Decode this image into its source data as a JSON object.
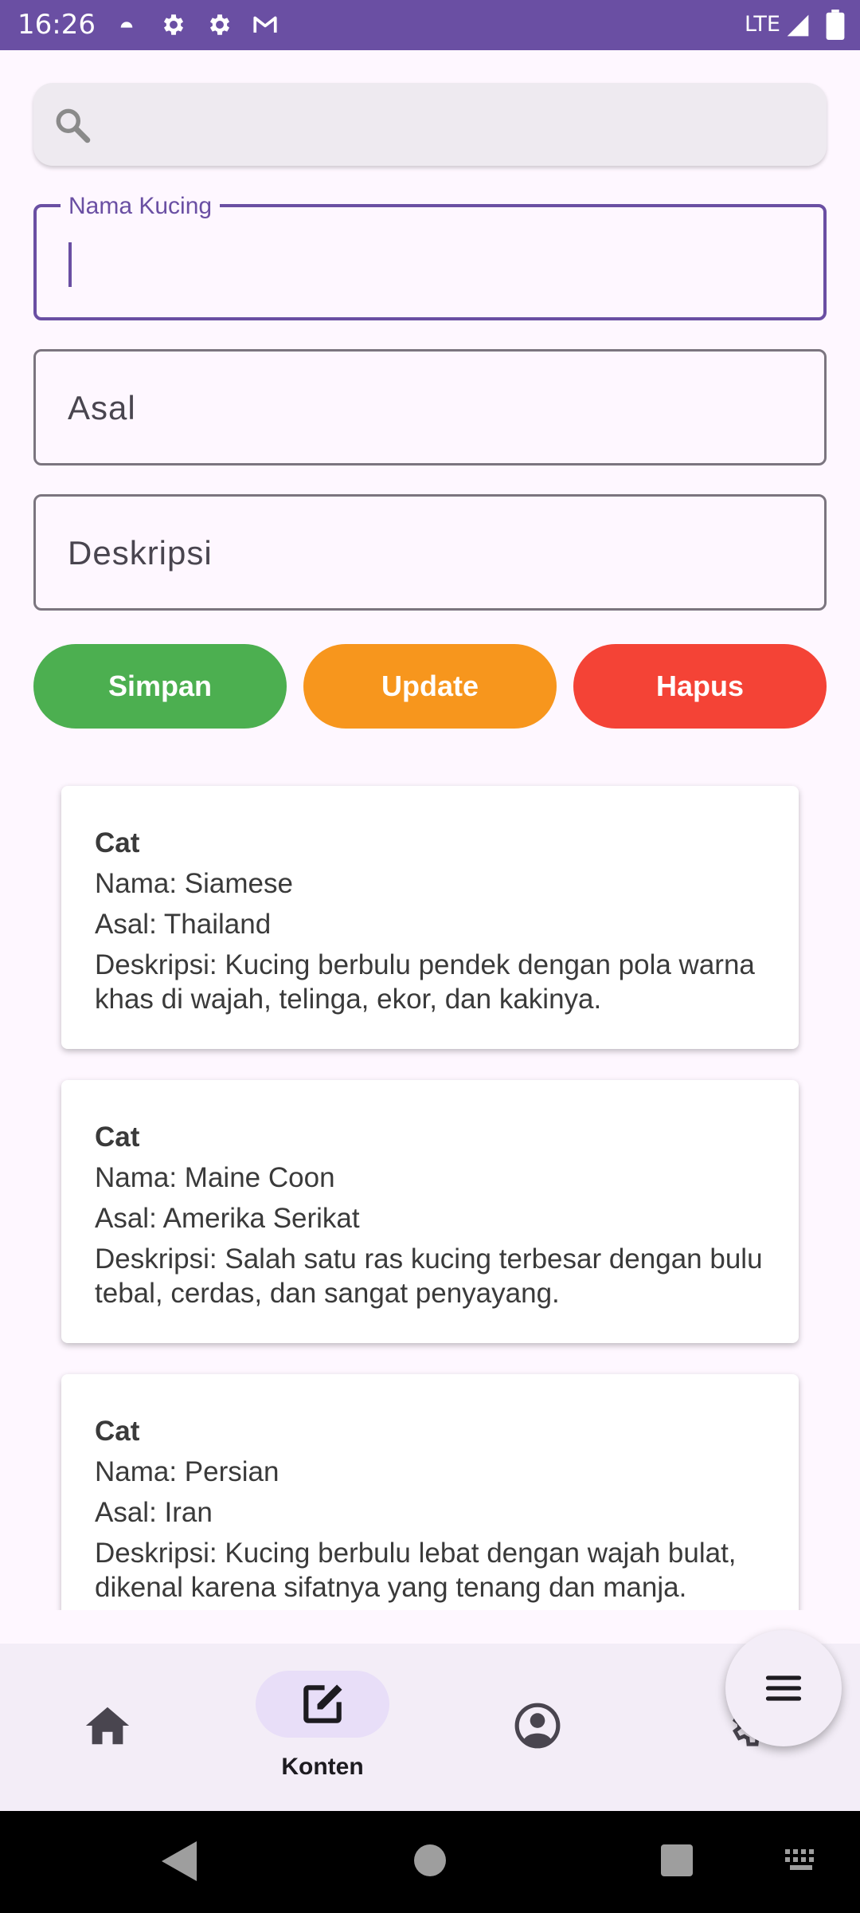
{
  "status_bar": {
    "time": "16:26",
    "network": "LTE",
    "icons": [
      "cloud-icon",
      "gear-icon",
      "gear-icon",
      "gmail-icon",
      "signal-icon",
      "battery-icon"
    ]
  },
  "search": {
    "placeholder": "",
    "value": ""
  },
  "form": {
    "name_label": "Nama Kucing",
    "name_value": "",
    "origin_placeholder": "Asal",
    "description_placeholder": "Deskripsi"
  },
  "buttons": {
    "save": "Simpan",
    "update": "Update",
    "delete": "Hapus"
  },
  "cats": [
    {
      "title": "Cat",
      "name": "Nama: Siamese",
      "origin": "Asal: Thailand",
      "description": "Deskripsi:  Kucing berbulu pendek dengan pola warna khas di wajah, telinga, ekor, dan kakinya."
    },
    {
      "title": "Cat",
      "name": "Nama: Maine Coon",
      "origin": "Asal: Amerika Serikat",
      "description": "Deskripsi: Salah satu ras kucing terbesar dengan bulu tebal, cerdas, dan sangat penyayang."
    },
    {
      "title": "Cat",
      "name": "Nama: Persian",
      "origin": "Asal: Iran",
      "description": "Deskripsi: Kucing berbulu lebat dengan wajah bulat, dikenal karena sifatnya yang tenang dan manja."
    }
  ],
  "bottom_nav": {
    "items": [
      {
        "icon": "home-icon",
        "label": ""
      },
      {
        "icon": "edit-icon",
        "label": "Konten",
        "active": true
      },
      {
        "icon": "profile-icon",
        "label": ""
      },
      {
        "icon": "settings-icon",
        "label": ""
      }
    ]
  },
  "fab": {
    "icon": "menu-icon"
  },
  "colors": {
    "status_bar": "#6A4FA3",
    "accent": "#6A4FA3",
    "save": "#4CAF50",
    "update": "#F7961D",
    "delete": "#F44336",
    "background": "#FEF7FF"
  }
}
